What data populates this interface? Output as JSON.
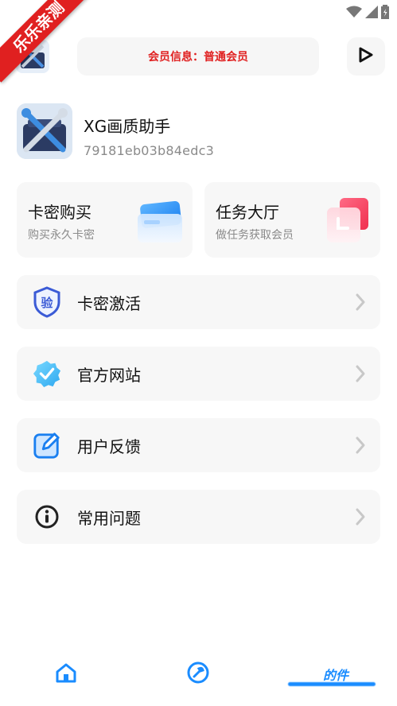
{
  "ribbon_text": "乐乐亲测",
  "header": {
    "member_info": "会员信息：普通会员"
  },
  "app": {
    "name": "XG画质助手",
    "code": "79181eb03b84edc3"
  },
  "cards": [
    {
      "title": "卡密购买",
      "subtitle": "购买永久卡密"
    },
    {
      "title": "任务大厅",
      "subtitle": "做任务获取会员"
    }
  ],
  "menu": [
    {
      "label": "卡密激活",
      "icon": "verify-shield-icon",
      "icon_text": "验"
    },
    {
      "label": "官方网站",
      "icon": "verified-badge-icon"
    },
    {
      "label": "用户反馈",
      "icon": "edit-feedback-icon"
    },
    {
      "label": "常用问题",
      "icon": "info-circle-icon"
    }
  ],
  "tabbar": {
    "tabs": [
      "home-icon",
      "tools-icon",
      "profile-icon"
    ],
    "active_tab_text": "的件"
  },
  "colors": {
    "accent": "#1a8cff",
    "member_red": "#e02020"
  }
}
